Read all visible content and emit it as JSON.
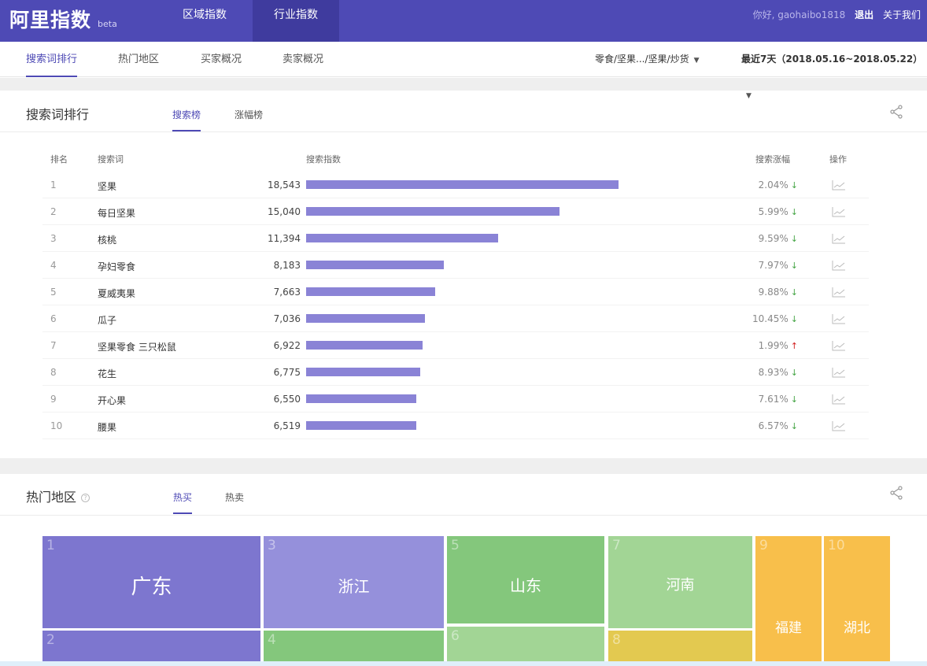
{
  "header": {
    "logo": "阿里指数",
    "beta": "beta",
    "nav": [
      "区域指数",
      "行业指数"
    ],
    "greeting": "你好, gaohaibo1818",
    "logout": "退出",
    "about": "关于我们"
  },
  "subnav": {
    "tabs": [
      "搜索词排行",
      "热门地区",
      "买家概况",
      "卖家概况"
    ],
    "category_filter": "零食/坚果.../坚果/炒货",
    "date_filter": "最近7天（2018.05.16~2018.05.22）"
  },
  "search_section": {
    "title": "搜索词排行",
    "tabs": [
      "搜索榜",
      "涨幅榜"
    ],
    "columns": {
      "rank": "排名",
      "keyword": "搜索词",
      "index": "搜索指数",
      "change": "搜索涨幅",
      "action": "操作"
    }
  },
  "chart_data": {
    "type": "bar",
    "categories": [
      "坚果",
      "每日坚果",
      "核桃",
      "孕妇零食",
      "夏威夷果",
      "瓜子",
      "坚果零食 三只松鼠",
      "花生",
      "开心果",
      "腰果"
    ],
    "values": [
      18543,
      15040,
      11394,
      8183,
      7663,
      7036,
      6922,
      6775,
      6550,
      6519
    ],
    "value_labels": [
      "18,543",
      "15,040",
      "11,394",
      "8,183",
      "7,663",
      "7,036",
      "6,922",
      "6,775",
      "6,550",
      "6,519"
    ],
    "ranks": [
      "1",
      "2",
      "3",
      "4",
      "5",
      "6",
      "7",
      "8",
      "9",
      "10"
    ],
    "changes": [
      "2.04%",
      "5.99%",
      "9.59%",
      "7.97%",
      "9.88%",
      "10.45%",
      "1.99%",
      "8.93%",
      "7.61%",
      "6.57%"
    ],
    "change_directions": [
      "down",
      "down",
      "down",
      "down",
      "down",
      "down",
      "up",
      "down",
      "down",
      "down"
    ],
    "bar_color": "#8a83d6"
  },
  "region_section": {
    "title": "热门地区",
    "tabs": [
      "热买",
      "热卖"
    ],
    "regions": [
      {
        "rank": "1",
        "name": "广东",
        "color": "#7d76cf"
      },
      {
        "rank": "2",
        "name": "",
        "color": "#7d76cf"
      },
      {
        "rank": "3",
        "name": "浙江",
        "color": "#9590db"
      },
      {
        "rank": "4",
        "name": "",
        "color": "#84c77c"
      },
      {
        "rank": "5",
        "name": "山东",
        "color": "#84c77c"
      },
      {
        "rank": "6",
        "name": "",
        "color": "#a2d595"
      },
      {
        "rank": "7",
        "name": "河南",
        "color": "#a2d595"
      },
      {
        "rank": "8",
        "name": "",
        "color": "#e3c950"
      },
      {
        "rank": "9",
        "name": "福建",
        "color": "#f8bf4b"
      },
      {
        "rank": "10",
        "name": "湖北",
        "color": "#f8bf4b"
      }
    ]
  },
  "colors": {
    "brand": "#4e4ab5",
    "down": "#45a545",
    "up": "#d22020"
  }
}
